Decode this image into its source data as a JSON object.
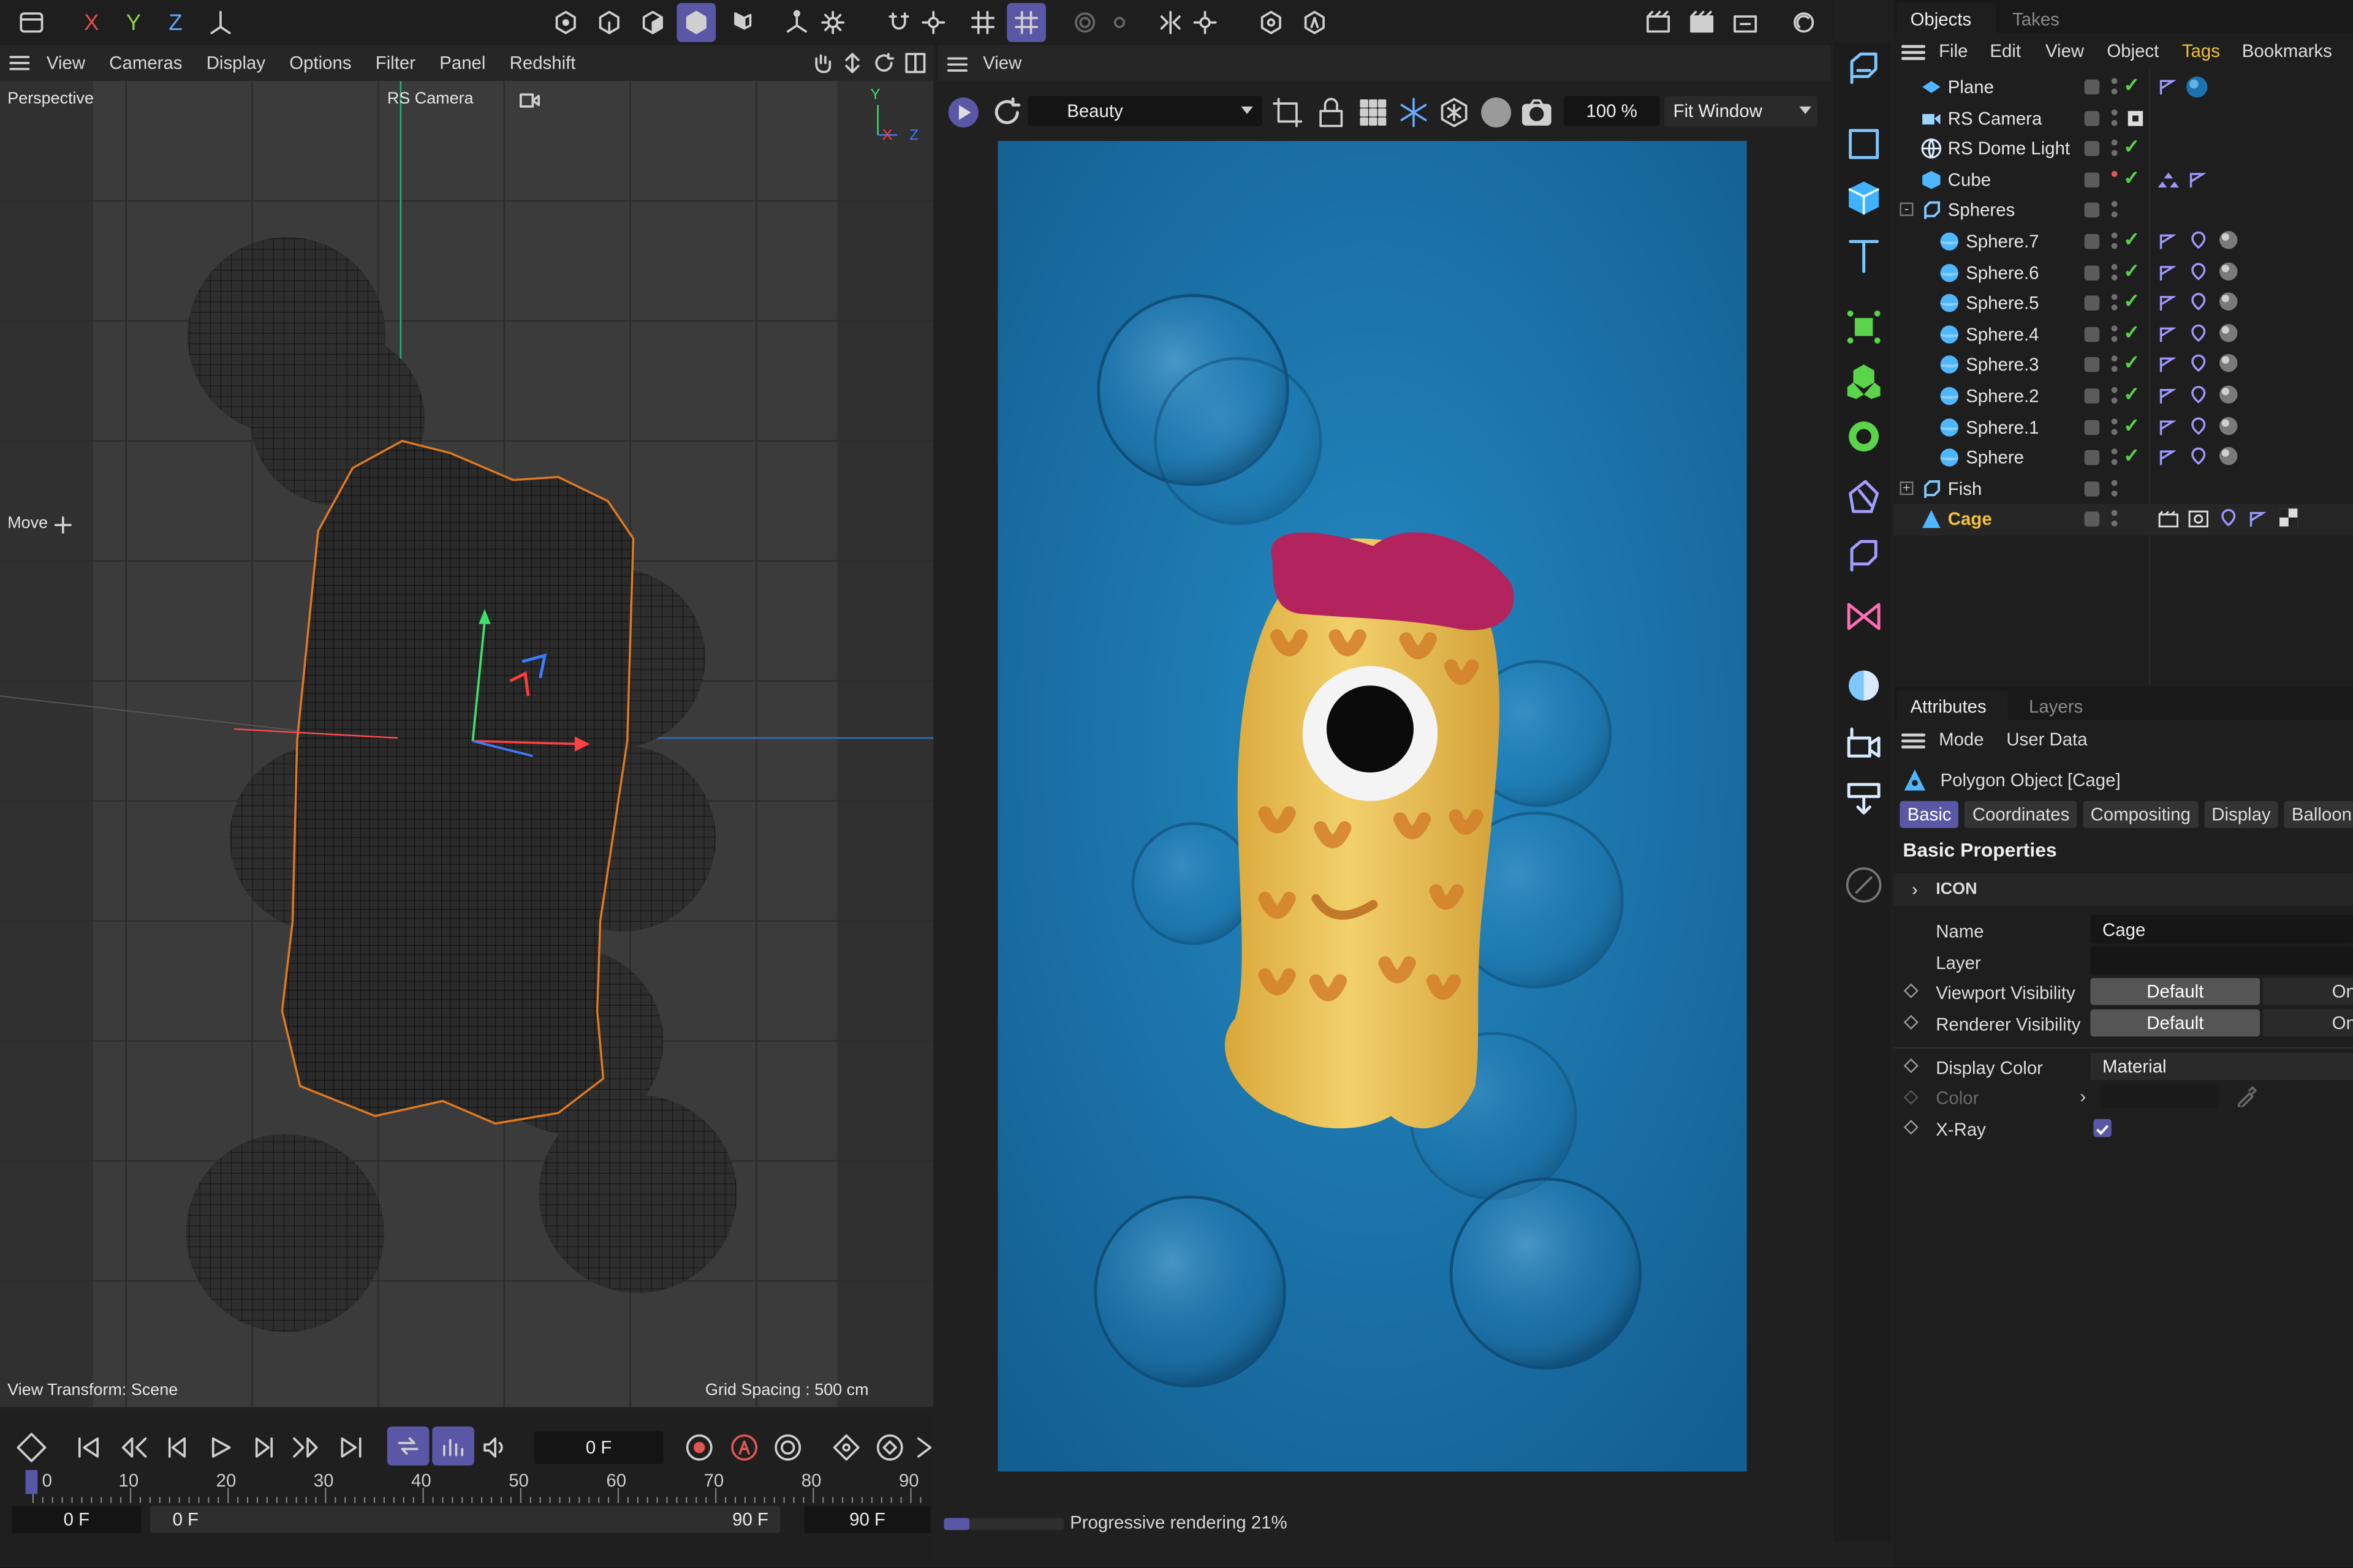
{
  "top_toolbar": {
    "axes": [
      "X",
      "Y",
      "Z"
    ]
  },
  "viewport": {
    "menu": [
      "View",
      "Cameras",
      "Display",
      "Options",
      "Filter",
      "Panel",
      "Redshift"
    ],
    "label_projection": "Perspective",
    "label_camera": "RS Camera",
    "axis_y": "Y",
    "axis_x": "X",
    "axis_z": "Z",
    "tool": "Move",
    "view_transform": "View Transform: Scene",
    "grid_spacing": "Grid Spacing : 500 cm"
  },
  "timeline": {
    "current_frame": "0 F",
    "ticks": [
      "0",
      "10",
      "20",
      "30",
      "40",
      "50",
      "60",
      "70",
      "80",
      "90"
    ],
    "start": "0 F",
    "range_start": "0 F",
    "range_end": "90 F",
    "end": "90 F"
  },
  "render_view": {
    "menu": "View",
    "pass": "Beauty",
    "zoom": "100 %",
    "fit": "Fit Window",
    "status": "Progressive rendering 21%",
    "progress": 0.21
  },
  "objects_panel": {
    "tabs": [
      "Objects",
      "Takes"
    ],
    "menu": [
      "File",
      "Edit",
      "View",
      "Object",
      "Tags",
      "Bookmarks"
    ],
    "active_menu": "Tags",
    "items": [
      {
        "name": "Plane",
        "indent": 0,
        "icon": "plane-icon",
        "check": true
      },
      {
        "name": "RS Camera",
        "indent": 0,
        "icon": "camera-icon",
        "check": false
      },
      {
        "name": "RS Dome Light",
        "indent": 0,
        "icon": "dome-light-icon",
        "check": true
      },
      {
        "name": "Cube",
        "indent": 0,
        "icon": "cube-icon",
        "check": true
      },
      {
        "name": "Spheres",
        "indent": 0,
        "icon": "null-group-icon",
        "check": false,
        "expandable": "-"
      },
      {
        "name": "Sphere.7",
        "indent": 1,
        "icon": "sphere-icon",
        "check": true
      },
      {
        "name": "Sphere.6",
        "indent": 1,
        "icon": "sphere-icon",
        "check": true
      },
      {
        "name": "Sphere.5",
        "indent": 1,
        "icon": "sphere-icon",
        "check": true
      },
      {
        "name": "Sphere.4",
        "indent": 1,
        "icon": "sphere-icon",
        "check": true
      },
      {
        "name": "Sphere.3",
        "indent": 1,
        "icon": "sphere-icon",
        "check": true
      },
      {
        "name": "Sphere.2",
        "indent": 1,
        "icon": "sphere-icon",
        "check": true
      },
      {
        "name": "Sphere.1",
        "indent": 1,
        "icon": "sphere-icon",
        "check": true
      },
      {
        "name": "Sphere",
        "indent": 1,
        "icon": "sphere-icon",
        "check": true
      },
      {
        "name": "Fish",
        "indent": 0,
        "icon": "null-group-icon",
        "check": false,
        "expandable": "+"
      },
      {
        "name": "Cage",
        "indent": 0,
        "icon": "polygon-icon",
        "check": false,
        "selected": true
      }
    ]
  },
  "attributes_panel": {
    "tabs": [
      "Attributes",
      "Layers"
    ],
    "menu": [
      "Mode",
      "User Data"
    ],
    "object": "Polygon Object [Cage]",
    "subtabs": [
      "Basic",
      "Coordinates",
      "Compositing",
      "Display",
      "Balloon"
    ],
    "section": "Basic Properties",
    "group": "ICON",
    "fields": {
      "name_label": "Name",
      "name_value": "Cage",
      "layer_label": "Layer",
      "vp_vis_label": "Viewport Visibility",
      "vp_vis_value": "Default",
      "vp_vis_alt": "On",
      "rn_vis_label": "Renderer Visibility",
      "rn_vis_value": "Default",
      "rn_vis_alt": "On",
      "disp_color_label": "Display Color",
      "disp_color_value": "Material",
      "color_label": "Color",
      "xray_label": "X-Ray"
    }
  },
  "colors": {
    "accent": "#5a57a6",
    "check": "#58d24b",
    "selected_text": "#f2c23a",
    "render_bg": "#1a78b0"
  }
}
